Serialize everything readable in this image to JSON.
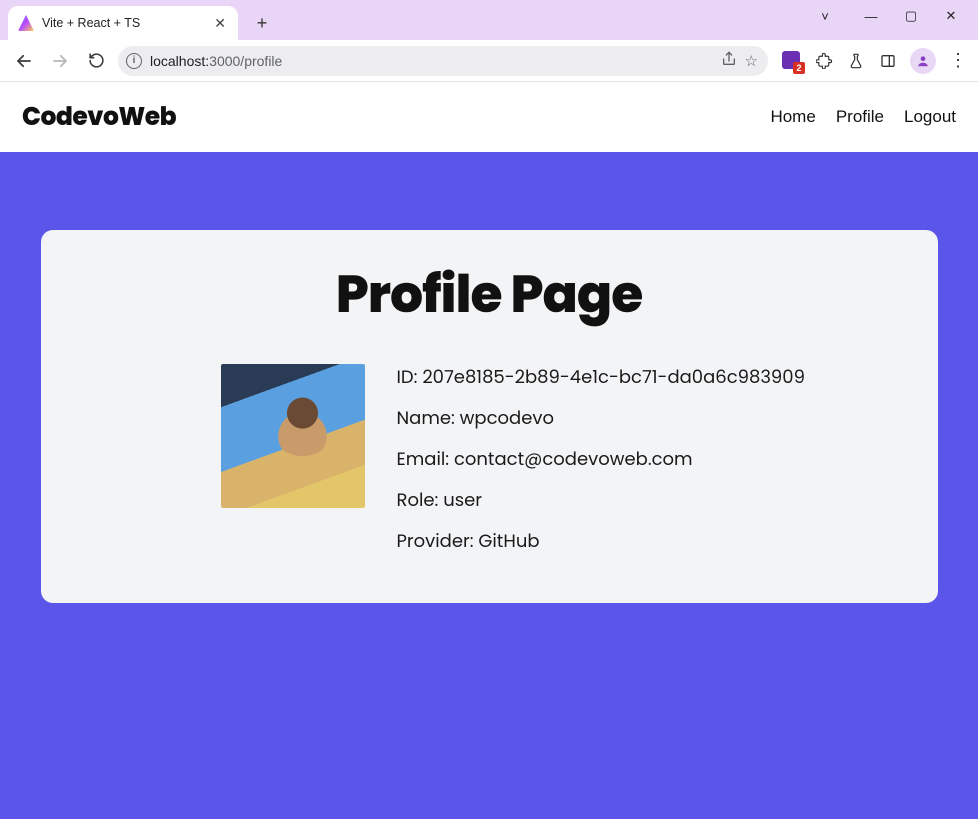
{
  "window": {
    "tab_title": "Vite + React + TS"
  },
  "address_bar": {
    "host": "localhost:",
    "port_path": "3000/profile"
  },
  "extensions": {
    "badge_count": "2"
  },
  "site": {
    "brand": "CodevoWeb",
    "nav": {
      "home": "Home",
      "profile": "Profile",
      "logout": "Logout"
    }
  },
  "page": {
    "title": "Profile Page",
    "labels": {
      "id": "ID:",
      "name": "Name:",
      "email": "Email:",
      "role": "Role:",
      "provider": "Provider:"
    },
    "user": {
      "id": "207e8185-2b89-4e1c-bc71-da0a6c983909",
      "name": "wpcodevo",
      "email": "contact@codevoweb.com",
      "role": "user",
      "provider": "GitHub"
    }
  }
}
